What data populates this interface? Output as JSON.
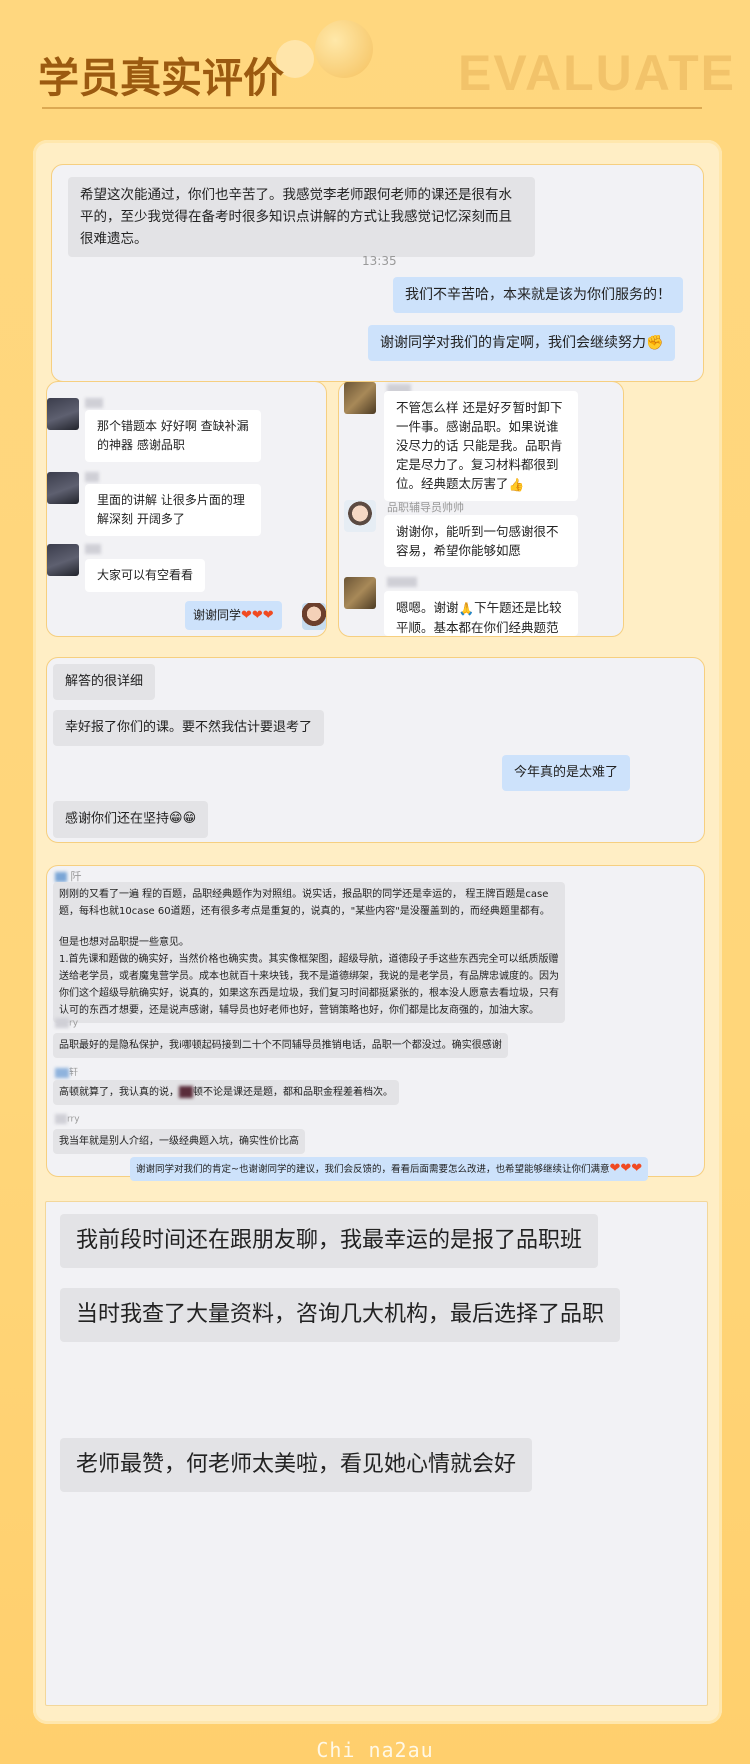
{
  "header": {
    "title": "学员真实评价",
    "title_en": "EVALUATE"
  },
  "card1": {
    "msg_left": "希望这次能通过，你们也辛苦了。我感觉李老师跟何老师的课还是很有水平的，至少我觉得在备考时很多知识点讲解的方式让我感觉记忆深刻而且很难遗忘。",
    "time": "13:35",
    "reply1": "我们不辛苦哈，本来就是该为你们服务的！",
    "reply2": "谢谢同学对我们的肯定啊，我们会继续努力",
    "reply2_emoji": "✊"
  },
  "card2": {
    "msg1": "那个错题本 好好啊 查缺补漏的神器 感谢品职",
    "msg2": "里面的讲解 让很多片面的理解深刻 开阔多了",
    "msg3": "大家可以有空看看",
    "reply": "谢谢同学",
    "reply_hearts": "❤❤❤"
  },
  "card3": {
    "msg1": "不管怎么样 还是好歹暂时卸下一件事。感谢品职。如果说谁没尽力的话 只能是我。品职肯定是尽力了。复习材料都很到位。经典题太厉害了",
    "msg1_emoji": "👍",
    "teacher_name": "品职辅导员帅帅",
    "msg2": "谢谢你，能听到一句感谢很不容易，希望你能够如愿",
    "msg3_a": "嗯嗯。谢谢",
    "msg3_emoji": "🙏",
    "msg3_b": "下午题还是比较平顺。基本都在你们经典题范畴"
  },
  "card4": {
    "msg1": "解答的很详细",
    "msg2": "幸好报了你们的课。要不然我估计要退考了",
    "reply": "今年真的是太难了",
    "msg3": "感谢你们还在坚持",
    "msg3_emoji": "😁😁"
  },
  "card5": {
    "nick1_tail": "阡",
    "long_p1": "刚刚的又看了一遍    程的百题，品职经典题作为对照组。说实话，报品职的同学还是幸运的，    程王牌百题是case题，每科也就10case 60道题，还有很多考点是重复的，说真的，\"某些内容\"是没覆盖到的，而经典题里都有。",
    "long_p2": "但是也想对品职提一些意见。",
    "long_p3": "1.首先课和题做的确实好，当然价格也确实贵。其实像框架图，超级导航，道德段子手这些东西完全可以纸质版赠送给老学员，或者魔鬼营学员。成本也就百十来块钱，我不是道德绑架，我说的是老学员，有品牌忠诚度的。因为你们这个超级导航确实好，说真的，如果这东西是垃圾，我们复习时间都挺紧张的，根本没人愿意去看垃圾，只有认可的东西才想要，还是说声感谢，辅导员也好老师也好，营销策略也好，你们都是比友商强的，加油大家。",
    "nick2_tail": "ry",
    "msg2": "品职最好的是隐私保护，我i哪顿起码接到二十个不同辅导员推销电话，品职一个都没过。确实很感谢",
    "nick3_tail": "轩",
    "msg3_a": "高顿就算了，我认真的说，",
    "msg3_b": "顿不论是课还是题，都和品职金程差着档次。",
    "nick4_tail": "rry",
    "msg4": "我当年就是别人介绍，一级经典题入坑，确实性价比高",
    "reply": "谢谢同学对我们的肯定~也谢谢同学的建议，我们会反馈的，看看后面需要怎么改进，也希望能够继续让你们满意",
    "reply_hearts": "❤❤❤"
  },
  "card6": {
    "msg1": "我前段时间还在跟朋友聊，我最幸运的是报了品职班",
    "msg2": "当时我查了大量资料，咨询几大机构，最后选择了品职",
    "msg3": "老师最赞，何老师太美啦，看见她心情就会好"
  },
  "footer": {
    "watermark": "Chi na2au"
  }
}
